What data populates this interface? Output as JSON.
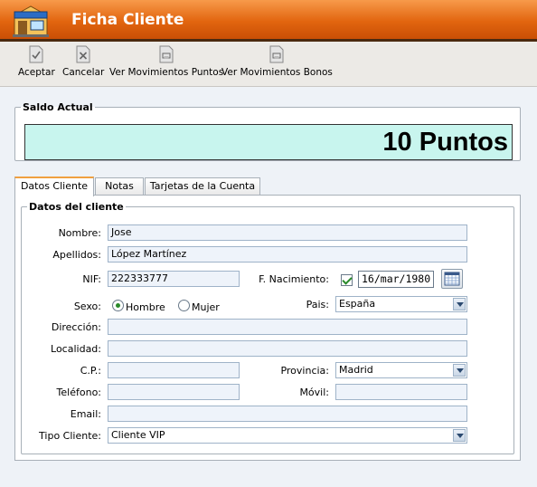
{
  "window": {
    "title": "Ficha Cliente"
  },
  "toolbar": {
    "accept": "Aceptar",
    "cancel": "Cancelar",
    "points_movements": "Ver Movimientos Puntos",
    "bonus_movements": "Ver Movimientos Bonos"
  },
  "saldo": {
    "legend": "Saldo Actual",
    "value": "10 Puntos"
  },
  "tabs": [
    {
      "label": "Datos Cliente",
      "active": true
    },
    {
      "label": "Notas",
      "active": false
    },
    {
      "label": "Tarjetas de la Cuenta",
      "active": false
    }
  ],
  "form": {
    "legend": "Datos del cliente",
    "nombre": {
      "label": "Nombre:",
      "value": "Jose"
    },
    "apellidos": {
      "label": "Apellidos:",
      "value": "López Martínez"
    },
    "nif": {
      "label": "NIF:",
      "value": "222333777"
    },
    "nacimiento": {
      "label": "F. Nacimiento:",
      "checked": true,
      "value": "16/mar/1980"
    },
    "sexo": {
      "label": "Sexo:",
      "options": [
        "Hombre",
        "Mujer"
      ],
      "selected": "Hombre"
    },
    "pais": {
      "label": "Pais:",
      "value": "España"
    },
    "direccion": {
      "label": "Dirección:",
      "value": ""
    },
    "localidad": {
      "label": "Localidad:",
      "value": ""
    },
    "cp": {
      "label": "C.P.:",
      "value": ""
    },
    "provincia": {
      "label": "Provincia:",
      "value": "Madrid"
    },
    "telefono": {
      "label": "Teléfono:",
      "value": ""
    },
    "movil": {
      "label": "Móvil:",
      "value": ""
    },
    "email": {
      "label": "Email:",
      "value": ""
    },
    "tipo_cliente": {
      "label": "Tipo Cliente:",
      "value": "Cliente VIP"
    }
  },
  "colors": {
    "header": "#e2650f",
    "saldo_bg": "#c8f5ee",
    "tab_accent": "#f0a040"
  }
}
